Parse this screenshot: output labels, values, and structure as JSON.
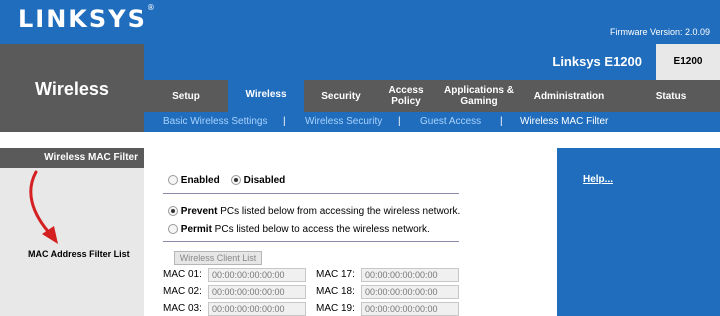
{
  "brand": {
    "logo_text": "LINKSYS",
    "trademark": "®",
    "firmware": "Firmware Version: 2.0.09"
  },
  "page": {
    "title": "Wireless"
  },
  "product": {
    "name": "Linksys E1200",
    "model": "E1200"
  },
  "tabs": [
    {
      "label": "Setup",
      "active": false
    },
    {
      "label": "Wireless",
      "active": true
    },
    {
      "label": "Security",
      "active": false
    },
    {
      "label": "Access\nPolicy",
      "active": false
    },
    {
      "label": "Applications &\nGaming",
      "active": false
    },
    {
      "label": "Administration",
      "active": false
    },
    {
      "label": "Status",
      "active": false
    }
  ],
  "subtabs": {
    "items": [
      "Basic Wireless Settings",
      "Wireless Security",
      "Guest Access",
      "Wireless MAC Filter"
    ],
    "separator": "|",
    "active": "Wireless MAC Filter"
  },
  "section": {
    "label": "Wireless MAC Filter",
    "filter_list_label": "MAC Address Filter List"
  },
  "help": {
    "label": "Help..."
  },
  "filter": {
    "enabled_label": "Enabled",
    "disabled_label": "Disabled",
    "selected": "Disabled",
    "prevent_bold": "Prevent",
    "prevent_rest": " PCs listed below from accessing the wireless network.",
    "permit_bold": "Permit",
    "permit_rest": " PCs listed below to access the wireless network.",
    "mode_selected": "Prevent"
  },
  "client_list_button": "Wireless Client List",
  "mac_entries": [
    {
      "label": "MAC 01:",
      "value": "00:00:00:00:00:00"
    },
    {
      "label": "MAC 02:",
      "value": "00:00:00:00:00:00"
    },
    {
      "label": "MAC 03:",
      "value": "00:00:00:00:00:00"
    },
    {
      "label": "MAC 17:",
      "value": "00:00:00:00:00:00"
    },
    {
      "label": "MAC 18:",
      "value": "00:00:00:00:00:00"
    },
    {
      "label": "MAC 19:",
      "value": "00:00:00:00:00:00"
    }
  ],
  "colors": {
    "brand_blue": "#1f6dbc",
    "dark_gray": "#5a5a5a",
    "arrow_red": "#d42020"
  },
  "icons": {
    "annotation_arrow": "red-curved-arrow-icon"
  }
}
